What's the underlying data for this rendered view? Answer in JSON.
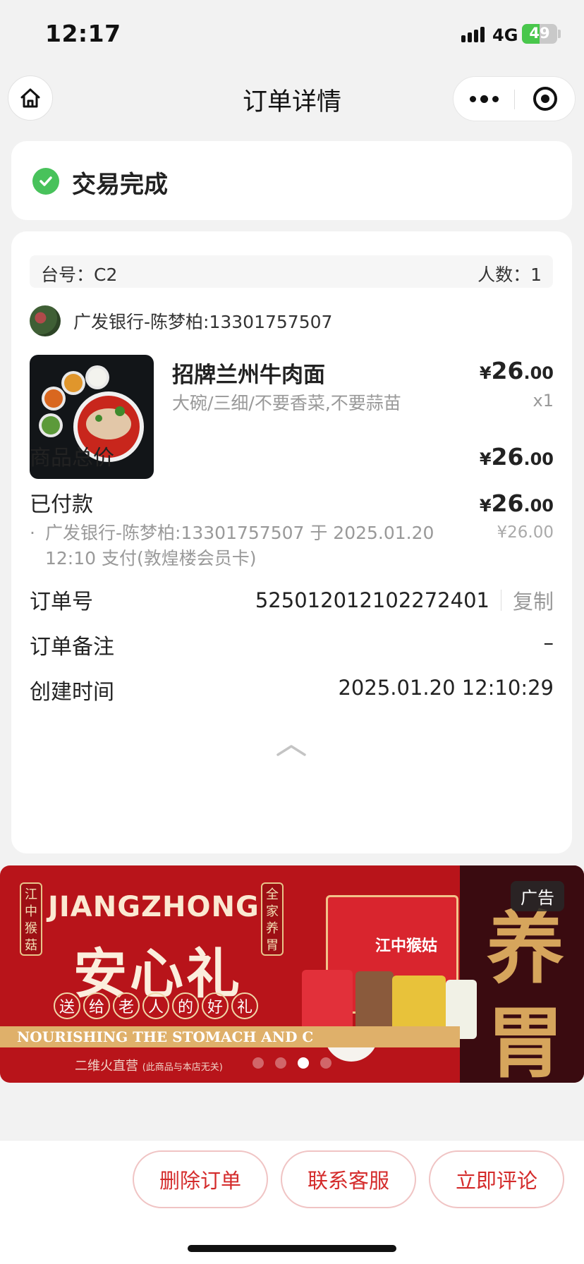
{
  "status_bar": {
    "time": "12:17",
    "network": "4G",
    "battery": "49",
    "battery_level": 0.49
  },
  "nav": {
    "title": "订单详情",
    "home_icon": "home-icon",
    "more_icon": "more-dots-icon",
    "close_icon": "target-close-icon"
  },
  "order_status": {
    "text": "交易完成",
    "icon": "check-circle-icon",
    "color": "#48c25b"
  },
  "table": {
    "table_label": "台号：C2",
    "people_label": "人数：1"
  },
  "payer": {
    "name": "广发银行-陈梦柏:13301757507"
  },
  "product": {
    "name": "招牌兰州牛肉面",
    "spec": "大碗/三细/不要香菜,不要蒜苗",
    "currency": "¥",
    "price_int": "26",
    "price_dec": ".00",
    "qty": "x1"
  },
  "summary": {
    "total_label": "商品总价",
    "total_int": "26",
    "total_dec": ".00",
    "paid_label": "已付款",
    "paid_int": "26",
    "paid_dec": ".00",
    "payment_note_bullet": "·",
    "payment_note": "广发银行-陈梦柏:13301757507 于 2025.01.20 12:10 支付(敦煌楼会员卡)",
    "payment_note_amount": "¥26.00",
    "order_no_label": "订单号",
    "order_no": "525012012102272401",
    "copy_label": "复制",
    "remark_label": "订单备注",
    "remark_value": "–",
    "created_label": "创建时间",
    "created_value": "2025.01.20 12:10:29",
    "collapse_icon": "chevron-up-icon"
  },
  "ad": {
    "tag": "广告",
    "vertical_left": "江中猴菇",
    "vertical_right": "全家养胃",
    "brand": "JIANGZHONG",
    "slogan": "安心礼",
    "sub_chars": [
      "送",
      "给",
      "老",
      "人",
      "的",
      "好",
      "礼"
    ],
    "strip": "NOURISHING THE STOMACH AND C",
    "disclaimer": "二维火直营",
    "disclaimer_small": "(此商品与本店无关)",
    "big_char_1": "养",
    "big_char_2": "胃",
    "box_label": "江中猴姑",
    "slide_count": 4,
    "active_slide": 3
  },
  "actions": {
    "delete": "删除订单",
    "contact": "联系客服",
    "review": "立即评论"
  }
}
